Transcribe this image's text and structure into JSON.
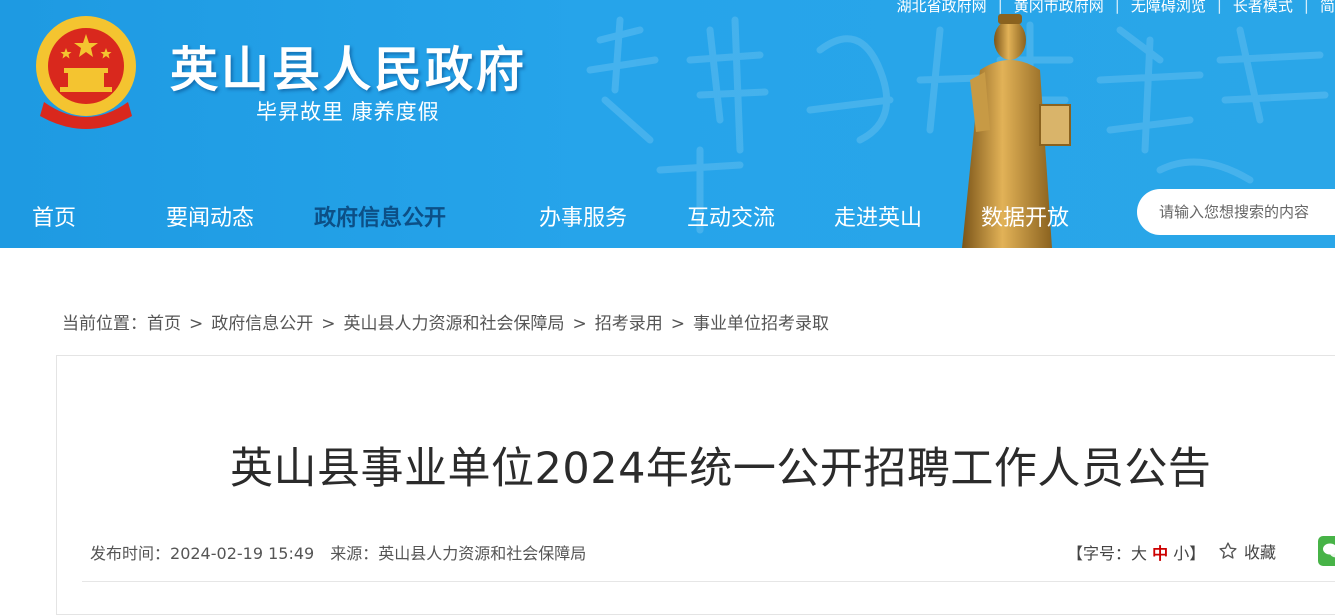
{
  "top_links": [
    "湖北省政府网",
    "黄冈市政府网",
    "无障碍浏览",
    "长者模式",
    "简"
  ],
  "site": {
    "title": "英山县人民政府",
    "slogan": "毕昇故里 康养度假"
  },
  "nav": {
    "items": [
      "首页",
      "要闻动态",
      "政府信息公开",
      "办事服务",
      "互动交流",
      "走进英山",
      "数据开放"
    ],
    "active": "政府信息公开"
  },
  "search": {
    "placeholder": "请输入您想搜索的内容"
  },
  "breadcrumb": {
    "label": "当前位置：",
    "items": [
      "首页",
      "政府信息公开",
      "英山县人力资源和社会保障局",
      "招考录用",
      "事业单位招考录取"
    ],
    "separator": ">"
  },
  "article": {
    "title": "英山县事业单位2024年统一公开招聘工作人员公告",
    "publish_label": "发布时间：",
    "publish_time": "2024-02-19 15:49",
    "source_label": "来源：",
    "source": "英山县人力资源和社会保障局"
  },
  "font_size": {
    "open": "【字号：",
    "large": "大",
    "medium": "中",
    "small": "小",
    "close": "】"
  },
  "favorite_label": "收藏",
  "colors": {
    "header_blue": "#26a4ea",
    "nav_active": "#0c4f86",
    "font_mid": "#cc0000",
    "wechat_green": "#47b347"
  }
}
